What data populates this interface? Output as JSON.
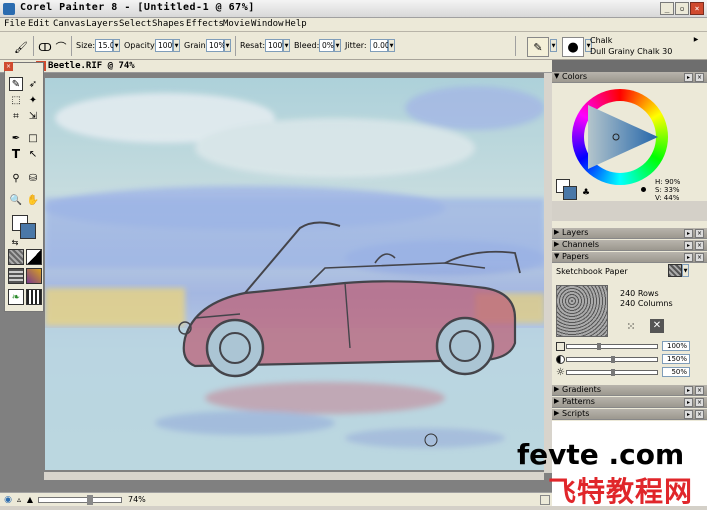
{
  "window": {
    "title": "Corel Painter 8 - [Untitled-1 @ 67%]",
    "minimize": "_",
    "restore": "▫",
    "close": "×"
  },
  "menu": [
    "File",
    "Edit",
    "Canvas",
    "Layers",
    "Select",
    "Shapes",
    "Effects",
    "Movie",
    "Window",
    "Help"
  ],
  "property_bar": {
    "size_label": "Size:",
    "size_value": "15.0",
    "opacity_label": "Opacity:",
    "opacity_value": "100%",
    "grain_label": "Grain:",
    "grain_value": "10%",
    "resat_label": "Resat:",
    "resat_value": "100%",
    "bleed_label": "Bleed:",
    "bleed_value": "0%",
    "jitter_label": "Jitter:",
    "jitter_value": "0.00"
  },
  "brush_selector": {
    "category": "Chalk",
    "variant": "Dull Grainy Chalk 30"
  },
  "document": {
    "title": "Beetle.RIF @ 74%",
    "zoom": "74%"
  },
  "panels": {
    "colors": {
      "title": "Colors",
      "h": "H: 90%",
      "s": "S: 33%",
      "v": "V: 44%"
    },
    "layers": {
      "title": "Layers"
    },
    "channels": {
      "title": "Channels"
    },
    "papers": {
      "title": "Papers",
      "selected": "Sketchbook Paper",
      "rows": "240 Rows",
      "columns": "240 Columns",
      "scale": "100%",
      "contrast": "150%",
      "brightness": "50%"
    },
    "gradients": {
      "title": "Gradients"
    },
    "patterns": {
      "title": "Patterns"
    },
    "scripts": {
      "title": "Scripts"
    }
  },
  "watermark": {
    "top": "fevte .com",
    "bottom": "飞特教程网"
  },
  "colors_accent": {
    "main_color": "#4a78a8",
    "titlebar": "#ece9d8"
  }
}
